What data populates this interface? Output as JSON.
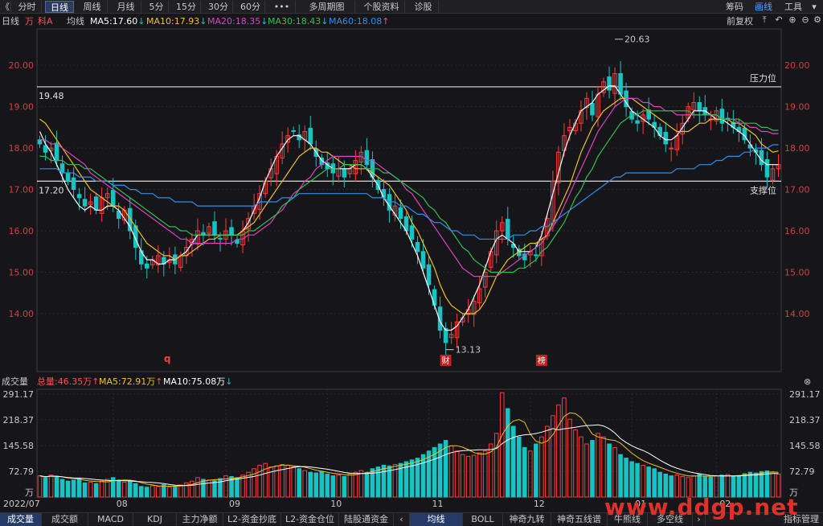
{
  "toolbar": {
    "back": "《",
    "tabs": [
      "分时",
      "日线",
      "周线",
      "月线",
      "5分",
      "15分",
      "30分",
      "60分",
      "•••",
      "多周期图",
      "个股资料",
      "诊股"
    ],
    "right": [
      "筹码",
      "画线",
      "工具"
    ],
    "active": "日线"
  },
  "info": {
    "period": "日线",
    "tag1": "万",
    "tag2": "科A",
    "avg": "均线",
    "ma5": "MA5:17.60",
    "ma10": "MA10:17.93",
    "ma20": "MA20:18.35",
    "ma30": "MA30:18.43",
    "ma60": "MA60:18.08",
    "adjust": "前复权"
  },
  "volinfo": {
    "title": "成交量",
    "total": "总量:46.35万",
    "ma5": "MA5:72.91万",
    "ma10": "MA10:75.08万"
  },
  "annotations": {
    "high": "20.63",
    "low": "13.13",
    "resist_value": "19.48",
    "support_value": "17.20",
    "resist_label": "压力位",
    "support_label": "支撑位",
    "marker_q": "q",
    "marker_cai": "财",
    "marker_bang": "榜"
  },
  "bottom_tabs": [
    "成交量",
    "成交额",
    "MACD",
    "KDJ",
    "主力净额",
    "L2-资金抄底",
    "L2-资金仓位",
    "陆股通资金",
    "均线",
    "BOLL",
    "神奇九转",
    "神奇五线谱",
    "牛熊线",
    "多空线"
  ],
  "bottom_right": "指标管理",
  "watermark": "www.ddgp.net",
  "colors": {
    "up": "#ff3b3b",
    "down": "#19c3c3",
    "ma5": "#ffffff",
    "ma10": "#f0c020",
    "ma20": "#e040c0",
    "ma30": "#30c050",
    "ma60": "#2f8fe8"
  },
  "chart_data": {
    "type": "candlestick",
    "x_ticks": [
      "2022/07",
      "08",
      "09",
      "10",
      "11",
      "12",
      "01",
      "02"
    ],
    "y_ticks": [
      "20.00",
      "19.00",
      "18.00",
      "17.00",
      "16.00",
      "15.00",
      "14.00"
    ],
    "ylim": [
      12.6,
      20.8
    ],
    "vol_ticks": [
      "291.17",
      "218.37",
      "145.58",
      "72.79",
      "万"
    ],
    "vol_max": 300,
    "hlines": [
      19.48,
      17.2
    ],
    "closes": [
      18.1,
      17.9,
      18.0,
      17.7,
      17.4,
      17.2,
      17.0,
      16.8,
      16.6,
      16.7,
      16.5,
      16.8,
      16.9,
      16.6,
      16.3,
      16.5,
      16.0,
      15.6,
      15.2,
      15.1,
      15.3,
      15.4,
      15.2,
      15.3,
      15.2,
      15.4,
      15.6,
      15.8,
      16.0,
      15.9,
      16.1,
      15.9,
      15.8,
      16.0,
      15.9,
      15.7,
      16.0,
      16.3,
      16.6,
      16.9,
      17.2,
      17.5,
      17.8,
      18.1,
      18.3,
      18.4,
      18.2,
      18.4,
      18.1,
      17.8,
      17.6,
      17.5,
      17.4,
      17.5,
      17.3,
      17.5,
      17.7,
      17.9,
      17.6,
      17.3,
      17.0,
      16.8,
      16.5,
      16.6,
      16.3,
      16.0,
      15.8,
      15.5,
      15.1,
      14.7,
      14.2,
      13.6,
      13.3,
      13.5,
      13.8,
      13.9,
      14.1,
      14.3,
      14.6,
      15.0,
      15.5,
      16.0,
      16.2,
      15.8,
      15.6,
      15.4,
      15.3,
      15.5,
      15.4,
      15.8,
      16.3,
      17.2,
      17.9,
      18.3,
      18.5,
      18.6,
      18.9,
      19.2,
      18.8,
      19.3,
      19.6,
      19.4,
      19.8,
      19.3,
      19.0,
      18.7,
      18.6,
      18.8,
      18.7,
      18.5,
      18.3,
      18.1,
      18.0,
      18.3,
      18.6,
      19.0,
      19.1,
      18.9,
      18.8,
      18.7,
      18.9,
      18.6,
      18.7,
      18.5,
      18.4,
      18.2,
      18.0,
      17.9,
      17.6,
      17.3,
      17.5,
      17.6
    ],
    "volumes": [
      60,
      55,
      62,
      58,
      50,
      45,
      48,
      52,
      40,
      42,
      38,
      45,
      50,
      55,
      48,
      42,
      44,
      38,
      30,
      28,
      32,
      30,
      35,
      28,
      30,
      34,
      40,
      45,
      55,
      50,
      48,
      46,
      52,
      60,
      58,
      55,
      62,
      70,
      80,
      90,
      95,
      85,
      88,
      92,
      90,
      86,
      80,
      75,
      70,
      68,
      72,
      65,
      60,
      62,
      58,
      66,
      70,
      75,
      70,
      80,
      85,
      90,
      88,
      92,
      95,
      100,
      105,
      110,
      120,
      130,
      140,
      150,
      160,
      145,
      130,
      120,
      115,
      118,
      125,
      130,
      150,
      180,
      295,
      250,
      200,
      170,
      140,
      130,
      150,
      170,
      200,
      230,
      260,
      280,
      220,
      190,
      170,
      150,
      160,
      180,
      170,
      150,
      140,
      120,
      110,
      100,
      95,
      90,
      85,
      80,
      70,
      65,
      60,
      62,
      58,
      55,
      60,
      65,
      58,
      56,
      60,
      62,
      64,
      58,
      60,
      66,
      70,
      68,
      72,
      74,
      70,
      65
    ],
    "series": [
      {
        "name": "MA5",
        "values": [
          18.4,
          18.1,
          17.9,
          17.6,
          17.3,
          17.0,
          16.8,
          16.6,
          16.5,
          16.6,
          16.5,
          16.5,
          16.6,
          16.6,
          16.5,
          16.3,
          16.1,
          15.8,
          15.5,
          15.3,
          15.3,
          15.2,
          15.2,
          15.3,
          15.3,
          15.4,
          15.5,
          15.7,
          15.9,
          15.9,
          15.9,
          15.9,
          15.9,
          15.9,
          15.9,
          15.9,
          16.0,
          16.2,
          16.5,
          16.8,
          17.2,
          17.5,
          17.8,
          18.0,
          18.2,
          18.3,
          18.3,
          18.2,
          18.1,
          17.9,
          17.7,
          17.6,
          17.5,
          17.5,
          17.5,
          17.5,
          17.6,
          17.6,
          17.5,
          17.3,
          17.1,
          16.8,
          16.6,
          16.4,
          16.2,
          16.0,
          15.7,
          15.4,
          15.0,
          14.6,
          14.2,
          13.8,
          13.6,
          13.6,
          13.7,
          13.9,
          14.1,
          14.4,
          14.7,
          15.1,
          15.5,
          15.8,
          15.9,
          15.8,
          15.7,
          15.5,
          15.5,
          15.5,
          15.6,
          15.9,
          16.4,
          16.9,
          17.4,
          17.9,
          18.3,
          18.6,
          18.9,
          19.0,
          19.1,
          19.3,
          19.4,
          19.5,
          19.5,
          19.3,
          19.1,
          18.9,
          18.8,
          18.7,
          18.6,
          18.5,
          18.3,
          18.2,
          18.2,
          18.3,
          18.5,
          18.7,
          18.9,
          18.9,
          18.9,
          18.8,
          18.7,
          18.7,
          18.6,
          18.5,
          18.4,
          18.3,
          18.1,
          17.9,
          17.7,
          17.6,
          17.6,
          17.6
        ]
      },
      {
        "name": "MA10",
        "values": [
          18.7,
          18.6,
          18.4,
          18.2,
          18.0,
          17.8,
          17.6,
          17.4,
          17.2,
          17.0,
          16.9,
          16.8,
          16.7,
          16.6,
          16.6,
          16.5,
          16.3,
          16.1,
          15.9,
          15.7,
          15.6,
          15.5,
          15.4,
          15.4,
          15.3,
          15.4,
          15.4,
          15.5,
          15.6,
          15.7,
          15.8,
          15.8,
          15.9,
          15.9,
          15.9,
          15.9,
          16.0,
          16.1,
          16.2,
          16.4,
          16.6,
          16.8,
          17.0,
          17.2,
          17.4,
          17.6,
          17.8,
          17.9,
          18.0,
          18.0,
          17.9,
          17.9,
          17.8,
          17.7,
          17.6,
          17.6,
          17.5,
          17.5,
          17.5,
          17.4,
          17.3,
          17.2,
          17.1,
          16.9,
          16.7,
          16.5,
          16.2,
          16.0,
          15.7,
          15.4,
          15.1,
          14.7,
          14.4,
          14.2,
          14.1,
          14.0,
          14.0,
          14.0,
          14.1,
          14.3,
          14.6,
          14.9,
          15.1,
          15.3,
          15.4,
          15.5,
          15.6,
          15.7,
          15.7,
          15.8,
          15.9,
          16.2,
          16.5,
          16.8,
          17.1,
          17.5,
          17.9,
          18.2,
          18.5,
          18.7,
          18.9,
          19.0,
          19.1,
          19.2,
          19.2,
          19.2,
          19.1,
          19.0,
          18.9,
          18.8,
          18.7,
          18.6,
          18.5,
          18.4,
          18.4,
          18.4,
          18.5,
          18.6,
          18.6,
          18.7,
          18.7,
          18.7,
          18.7,
          18.6,
          18.6,
          18.5,
          18.4,
          18.3,
          18.1,
          18.0,
          17.9,
          17.93
        ]
      },
      {
        "name": "MA20",
        "values": [
          18.2,
          18.2,
          18.1,
          18.1,
          18.0,
          17.9,
          17.8,
          17.7,
          17.6,
          17.4,
          17.3,
          17.2,
          17.1,
          17.0,
          16.9,
          16.8,
          16.7,
          16.6,
          16.5,
          16.4,
          16.3,
          16.2,
          16.1,
          16.0,
          15.9,
          15.8,
          15.8,
          15.7,
          15.7,
          15.7,
          15.7,
          15.7,
          15.7,
          15.7,
          15.7,
          15.8,
          15.8,
          15.9,
          15.9,
          16.0,
          16.1,
          16.2,
          16.4,
          16.5,
          16.7,
          16.9,
          17.0,
          17.2,
          17.3,
          17.5,
          17.6,
          17.7,
          17.8,
          17.8,
          17.8,
          17.8,
          17.8,
          17.8,
          17.7,
          17.7,
          17.6,
          17.5,
          17.4,
          17.3,
          17.2,
          17.0,
          16.9,
          16.7,
          16.5,
          16.3,
          16.1,
          15.9,
          15.7,
          15.5,
          15.3,
          15.1,
          15.0,
          14.9,
          14.9,
          14.9,
          14.9,
          14.9,
          15.0,
          15.1,
          15.2,
          15.3,
          15.4,
          15.5,
          15.6,
          15.7,
          15.9,
          16.1,
          16.3,
          16.6,
          16.9,
          17.2,
          17.5,
          17.8,
          18.1,
          18.4,
          18.6,
          18.8,
          19.0,
          19.1,
          19.2,
          19.2,
          19.2,
          19.1,
          19.1,
          19.0,
          19.0,
          18.9,
          18.9,
          18.8,
          18.8,
          18.8,
          18.8,
          18.8,
          18.8,
          18.8,
          18.8,
          18.7,
          18.7,
          18.7,
          18.6,
          18.6,
          18.5,
          18.5,
          18.4,
          18.4,
          18.35,
          18.35
        ]
      },
      {
        "name": "MA30",
        "values": [
          17.8,
          17.8,
          17.7,
          17.7,
          17.7,
          17.6,
          17.6,
          17.6,
          17.5,
          17.5,
          17.4,
          17.3,
          17.2,
          17.1,
          17.0,
          16.9,
          16.8,
          16.7,
          16.6,
          16.5,
          16.4,
          16.3,
          16.2,
          16.1,
          16.1,
          16.0,
          16.0,
          15.9,
          15.9,
          15.9,
          15.9,
          15.9,
          15.9,
          15.9,
          15.9,
          15.9,
          15.9,
          16.0,
          16.0,
          16.1,
          16.2,
          16.3,
          16.4,
          16.6,
          16.7,
          16.8,
          17.0,
          17.1,
          17.2,
          17.3,
          17.4,
          17.5,
          17.5,
          17.5,
          17.6,
          17.6,
          17.6,
          17.6,
          17.5,
          17.5,
          17.5,
          17.4,
          17.4,
          17.3,
          17.2,
          17.1,
          17.0,
          16.9,
          16.8,
          16.6,
          16.5,
          16.3,
          16.2,
          16.0,
          15.8,
          15.6,
          15.5,
          15.3,
          15.2,
          15.1,
          15.0,
          15.0,
          15.0,
          15.0,
          15.0,
          15.1,
          15.1,
          15.2,
          15.3,
          15.5,
          15.6,
          15.8,
          16.0,
          16.2,
          16.5,
          16.8,
          17.0,
          17.3,
          17.5,
          17.8,
          18.0,
          18.2,
          18.4,
          18.6,
          18.7,
          18.8,
          18.8,
          18.9,
          18.9,
          18.9,
          18.9,
          18.9,
          18.9,
          18.9,
          18.9,
          18.9,
          18.8,
          18.8,
          18.8,
          18.8,
          18.8,
          18.7,
          18.7,
          18.7,
          18.7,
          18.6,
          18.6,
          18.6,
          18.5,
          18.5,
          18.43,
          18.43
        ]
      },
      {
        "name": "MA60",
        "values": [
          17.5,
          17.5,
          17.5,
          17.5,
          17.4,
          17.4,
          17.4,
          17.3,
          17.3,
          17.3,
          17.2,
          17.2,
          17.2,
          17.1,
          17.1,
          17.1,
          17.0,
          17.0,
          16.9,
          16.9,
          16.9,
          16.8,
          16.8,
          16.8,
          16.7,
          16.7,
          16.7,
          16.7,
          16.6,
          16.6,
          16.6,
          16.6,
          16.6,
          16.6,
          16.6,
          16.6,
          16.6,
          16.6,
          16.6,
          16.7,
          16.7,
          16.7,
          16.7,
          16.8,
          16.8,
          16.8,
          16.9,
          16.9,
          16.9,
          16.9,
          16.9,
          16.9,
          16.9,
          16.9,
          16.9,
          16.9,
          16.9,
          16.9,
          16.9,
          16.8,
          16.8,
          16.8,
          16.7,
          16.7,
          16.6,
          16.6,
          16.5,
          16.4,
          16.4,
          16.3,
          16.2,
          16.2,
          16.1,
          16.0,
          16.0,
          15.9,
          15.9,
          15.9,
          15.8,
          15.8,
          15.8,
          15.8,
          15.8,
          15.8,
          15.9,
          15.9,
          15.9,
          16.0,
          16.0,
          16.1,
          16.1,
          16.2,
          16.3,
          16.4,
          16.5,
          16.6,
          16.7,
          16.8,
          16.9,
          17.0,
          17.1,
          17.2,
          17.3,
          17.3,
          17.4,
          17.4,
          17.4,
          17.4,
          17.4,
          17.4,
          17.4,
          17.4,
          17.4,
          17.5,
          17.5,
          17.5,
          17.5,
          17.6,
          17.6,
          17.6,
          17.7,
          17.7,
          17.8,
          17.8,
          17.8,
          17.9,
          17.9,
          18.0,
          18.0,
          18.0,
          18.08,
          18.08
        ]
      }
    ]
  }
}
